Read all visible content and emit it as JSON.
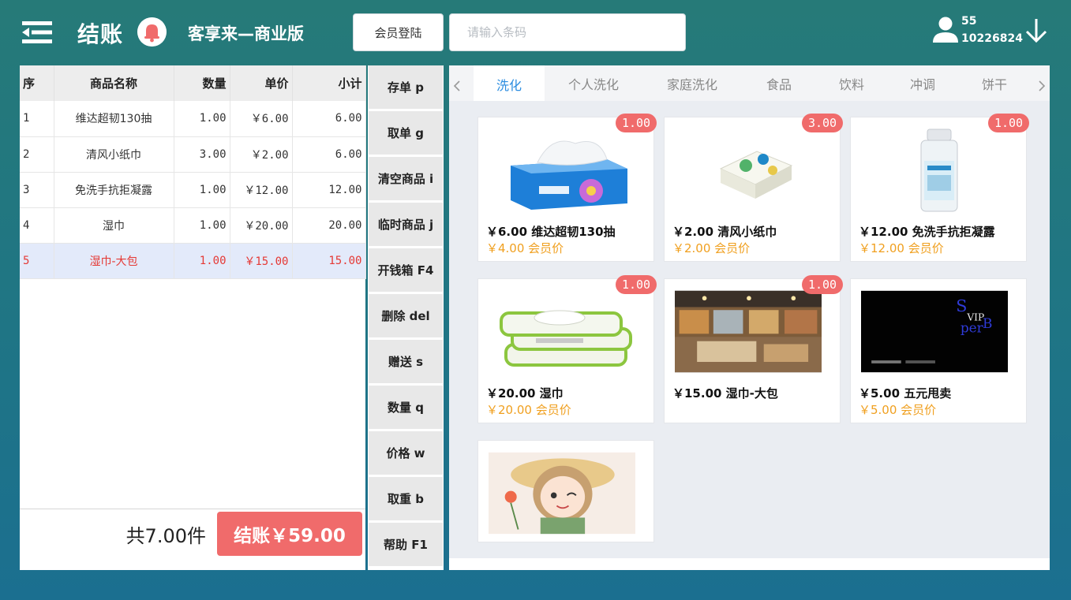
{
  "header": {
    "title": "结账",
    "app_name": "客享来—商业版",
    "member_login_label": "会员登陆",
    "barcode_placeholder": "请输入条码",
    "user_id": "55",
    "user_no": "10226824"
  },
  "order": {
    "columns": [
      "序",
      "商品名称",
      "数量",
      "单价",
      "小计"
    ],
    "rows": [
      {
        "idx": "1",
        "name": "维达超韧130抽",
        "qty": "1.00",
        "price": "￥6.00",
        "subtotal": "6.00"
      },
      {
        "idx": "2",
        "name": "清风小纸巾",
        "qty": "3.00",
        "price": "￥2.00",
        "subtotal": "6.00"
      },
      {
        "idx": "3",
        "name": "免洗手抗拒凝露",
        "qty": "1.00",
        "price": "￥12.00",
        "subtotal": "12.00"
      },
      {
        "idx": "4",
        "name": "湿巾",
        "qty": "1.00",
        "price": "￥20.00",
        "subtotal": "20.00"
      },
      {
        "idx": "5",
        "name": "湿巾-大包",
        "qty": "1.00",
        "price": "￥15.00",
        "subtotal": "15.00"
      }
    ],
    "selected_row": "5",
    "total_count": "共7.00件",
    "checkout_label": "结账￥59.00"
  },
  "functions": [
    "存单 p",
    "取单 g",
    "清空商品 i",
    "临时商品 j",
    "开钱箱 F4",
    "删除 del",
    "赠送 s",
    "数量 q",
    "价格 w",
    "取重 b",
    "帮助 F1"
  ],
  "tabs": [
    "洗化",
    "个人洗化",
    "家庭洗化",
    "食品",
    "饮料",
    "冲调",
    "饼干"
  ],
  "active_tab": "洗化",
  "products": [
    {
      "price_name": "￥6.00 维达超韧130抽",
      "member_price": "￥4.00 会员价",
      "badge": "1.00",
      "icon": "tissue-box-image"
    },
    {
      "price_name": "￥2.00 清风小纸巾",
      "member_price": "￥2.00 会员价",
      "badge": "3.00",
      "icon": "tissue-pack-image"
    },
    {
      "price_name": "￥12.00 免洗手抗拒凝露",
      "member_price": "￥12.00 会员价",
      "badge": "1.00",
      "icon": "sanitizer-bottle-image"
    },
    {
      "price_name": "￥20.00 湿巾",
      "member_price": "￥20.00 会员价",
      "badge": "1.00",
      "icon": "wet-wipes-image"
    },
    {
      "price_name": "￥15.00 湿巾-大包",
      "member_price": "",
      "badge": "1.00",
      "icon": "store-interior-image"
    },
    {
      "price_name": "￥5.00 五元甩卖",
      "member_price": "￥5.00 会员价",
      "badge": "",
      "icon": "vip-poster-image",
      "poster_text": "VIP"
    },
    {
      "price_name": "",
      "member_price": "",
      "badge": "",
      "icon": "cartoon-girl-image"
    }
  ],
  "colors": {
    "accent": "#f06b6b",
    "member_price": "#f0a020",
    "active_tab": "#2c8de0",
    "selected_row_bg": "#e3eafa"
  }
}
